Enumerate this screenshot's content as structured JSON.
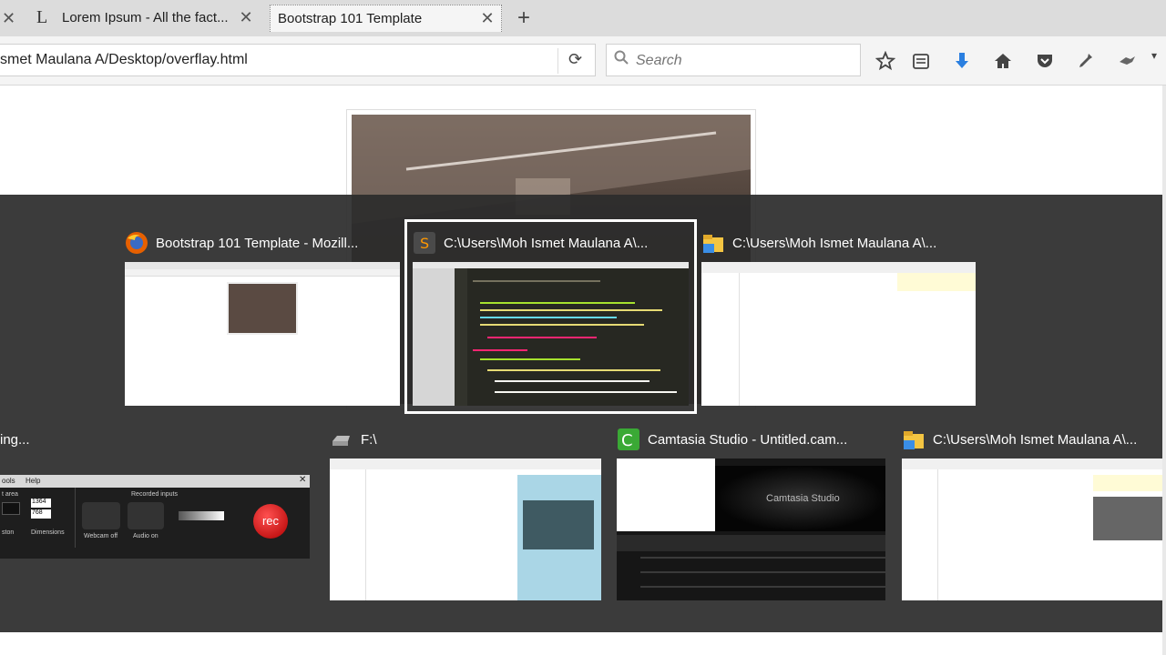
{
  "tabs": [
    {
      "title": "Lorem Ipsum - All the fact...",
      "favicon_glyph": "L"
    },
    {
      "title": "Bootstrap 101 Template"
    }
  ],
  "urlbar": {
    "url": "smet Maulana A/Desktop/overflay.html"
  },
  "search": {
    "placeholder": "Search"
  },
  "switcher": {
    "row1": [
      {
        "title": "Bootstrap 101 Template - Mozill..."
      },
      {
        "title": "C:\\Users\\Moh Ismet Maulana A\\..."
      },
      {
        "title": "C:\\Users\\Moh Ismet Maulana A\\..."
      }
    ],
    "row2": [
      {
        "title": "ing..."
      },
      {
        "title": "F:\\"
      },
      {
        "title": "Camtasia Studio - Untitled.cam..."
      },
      {
        "title": "C:\\Users\\Moh Ismet Maulana A\\..."
      }
    ],
    "recorder": {
      "menu_tools": "ools",
      "menu_help": "Help",
      "area_label": "t area",
      "width_value": "1364",
      "height_value": "768",
      "custom_label": "ston",
      "dimensions_label": "Dimensions",
      "inputs_label": "Recorded inputs",
      "webcam_label": "Webcam off",
      "audio_label": "Audio on",
      "rec_label": "rec"
    },
    "camtasia_splash": "Camtasia Studio"
  },
  "colors": {
    "overlay": "#2c2c2c",
    "firefox_orange": "#e66000",
    "camtasia_green": "#3aa935",
    "folder_yellow": "#f4c542",
    "rec_red": "#d62020"
  }
}
